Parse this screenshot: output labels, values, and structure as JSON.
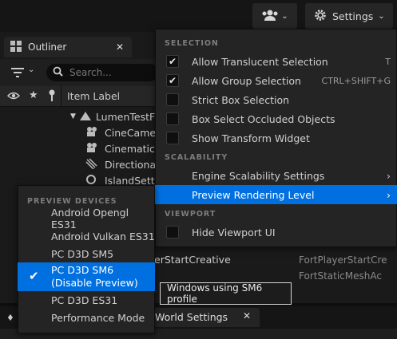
{
  "toolbar": {
    "settings_label": "Settings"
  },
  "outliner": {
    "tab_label": "Outliner",
    "search_placeholder": "Search...",
    "item_label_header": "Item Label",
    "rows": [
      "LumenTestF",
      "CineCamer",
      "Cinematic",
      "Directional",
      "IslandSetti"
    ],
    "row_partial": "erStartCreative",
    "type_partial_1": "FortPlayerStartCre",
    "type_partial_2": "FortStaticMeshAc"
  },
  "bottom_tab": {
    "label": "World Settings"
  },
  "settings_menu": {
    "selection_header": "SELECTION",
    "items": [
      {
        "label": "Allow Translucent Selection",
        "checked": true,
        "shortcut": "T"
      },
      {
        "label": "Allow Group Selection",
        "checked": true,
        "shortcut": "CTRL+SHIFT+G"
      },
      {
        "label": "Strict Box Selection",
        "checked": false,
        "shortcut": ""
      },
      {
        "label": "Box Select Occluded Objects",
        "checked": false,
        "shortcut": ""
      },
      {
        "label": "Show Transform Widget",
        "checked": false,
        "shortcut": ""
      }
    ],
    "scalability_header": "SCALABILITY",
    "engine_scalability": "Engine Scalability Settings",
    "preview_rendering": "Preview Rendering Level",
    "viewport_header": "VIEWPORT",
    "hide_viewport_ui": "Hide Viewport UI"
  },
  "preview_menu": {
    "header": "PREVIEW DEVICES",
    "items": [
      "Android Opengl ES31",
      "Android Vulkan ES31",
      "PC D3D SM5",
      "PC D3D SM6",
      "PC D3D ES31",
      "Performance Mode"
    ],
    "selected_suffix": "(Disable Preview)"
  },
  "tooltip": {
    "text": "Windows using SM6 profile"
  }
}
